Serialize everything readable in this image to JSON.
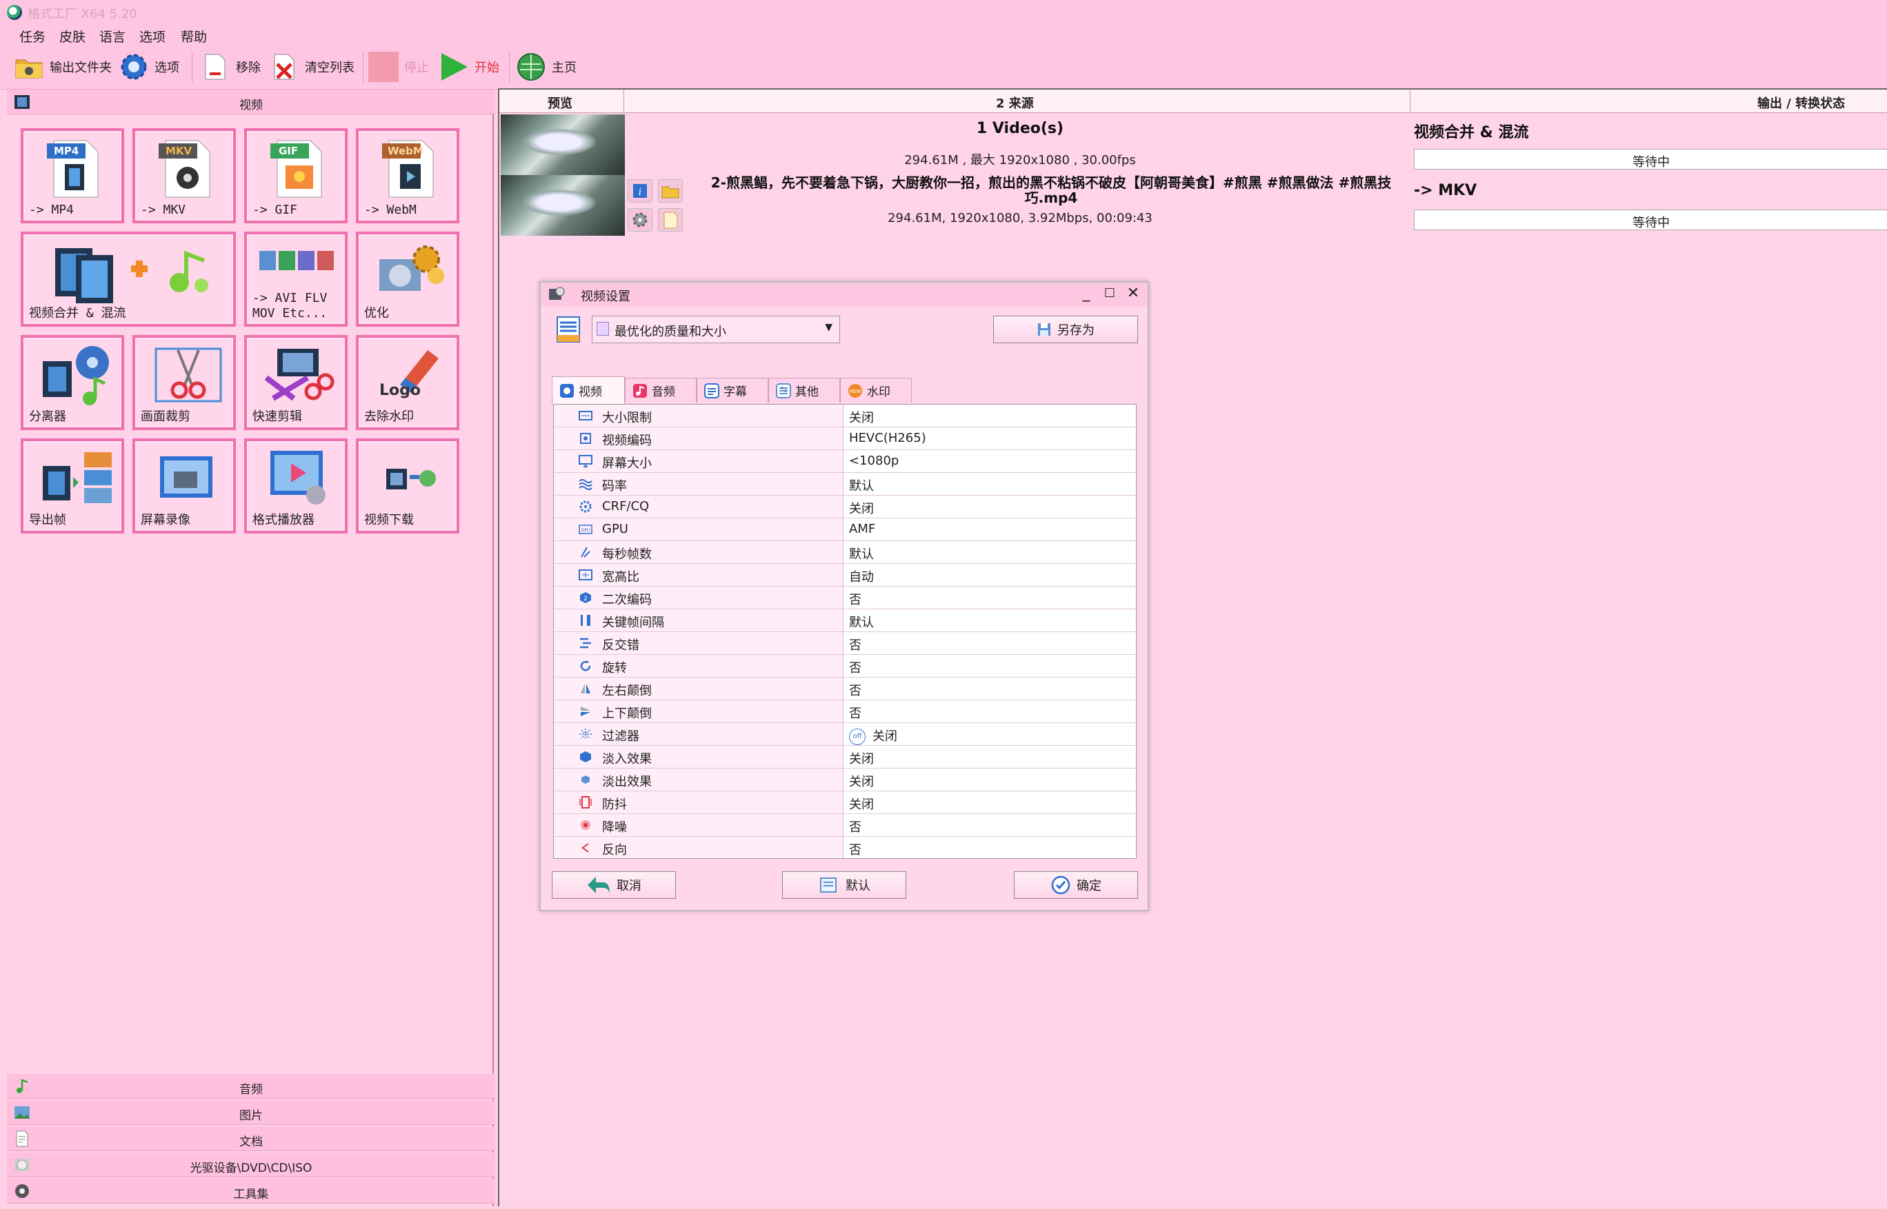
{
  "window": {
    "title": "格式工厂 X64 5.20"
  },
  "menu": [
    "任务",
    "皮肤",
    "语言",
    "选项",
    "帮助"
  ],
  "toolbar": {
    "output_folder": "输出文件夹",
    "options": "选项",
    "remove": "移除",
    "clear_list": "清空列表",
    "stop": "停止",
    "start": "开始",
    "home": "主页"
  },
  "left": {
    "video_category": "视频",
    "tiles": [
      {
        "badge": "MP4",
        "label": "-> MP4"
      },
      {
        "badge": "MKV",
        "label": "-> MKV"
      },
      {
        "badge": "GIF",
        "label": "-> GIF"
      },
      {
        "badge": "WebM",
        "label": "-> WebM"
      },
      {
        "label": "视频合并 & 混流"
      },
      {
        "label1": "-> AVI FLV",
        "label2": "MOV Etc..."
      },
      {
        "label": "优化"
      },
      {
        "label": "分离器"
      },
      {
        "label": "画面裁剪"
      },
      {
        "label": "快速剪辑"
      },
      {
        "label": "去除水印",
        "art": "Logo"
      },
      {
        "label": "导出帧"
      },
      {
        "label": "屏幕录像"
      },
      {
        "label": "格式播放器"
      },
      {
        "label": "视频下载"
      }
    ],
    "bottom_categories": [
      "音频",
      "图片",
      "文档",
      "光驱设备\\DVD\\CD\\ISO",
      "工具集"
    ]
  },
  "list": {
    "headers": {
      "preview": "预览",
      "source": "2 来源",
      "output": "输出 / 转换状态"
    },
    "rows": [
      {
        "title": "1 Video(s)",
        "info": "294.61M , 最大 1920x1080 , 30.00fps",
        "output": "视频合并 & 混流",
        "status": "等待中"
      },
      {
        "title": "2-煎黑鲳，先不要着急下锅，大厨教你一招，煎出的黑不粘锅不破皮【阿朝哥美食】#煎黑 #煎黑做法 #煎黑技巧.mp4",
        "info": "294.61M, 1920x1080, 3.92Mbps, 00:09:43",
        "output": "-> MKV",
        "status": "等待中"
      }
    ]
  },
  "dialog": {
    "title": "视频设置",
    "profile": "最优化的质量和大小",
    "save_as": "另存为",
    "tabs": [
      "视频",
      "音频",
      "字幕",
      "其他",
      "水印"
    ],
    "settings": [
      {
        "name": "大小限制",
        "value": "关闭"
      },
      {
        "name": "视频编码",
        "value": "HEVC(H265)"
      },
      {
        "name": "屏幕大小",
        "value": "<1080p"
      },
      {
        "name": "码率",
        "value": "默认"
      },
      {
        "name": "CRF/CQ",
        "value": "关闭"
      },
      {
        "name": "GPU",
        "value": "AMF"
      },
      {
        "name": "每秒帧数",
        "value": "默认"
      },
      {
        "name": "宽高比",
        "value": "自动"
      },
      {
        "name": "二次编码",
        "value": "否"
      },
      {
        "name": "关键帧间隔",
        "value": "默认"
      },
      {
        "name": "反交错",
        "value": "否"
      },
      {
        "name": "旋转",
        "value": "否"
      },
      {
        "name": "左右颠倒",
        "value": "否"
      },
      {
        "name": "上下颠倒",
        "value": "否"
      },
      {
        "name": "过滤器",
        "value": "关闭",
        "badge": "off"
      },
      {
        "name": "淡入效果",
        "value": "关闭"
      },
      {
        "name": "淡出效果",
        "value": "关闭"
      },
      {
        "name": "防抖",
        "value": "关闭"
      },
      {
        "name": "降噪",
        "value": "否"
      },
      {
        "name": "反向",
        "value": "否"
      }
    ],
    "cancel": "取消",
    "default": "默认",
    "ok": "确定"
  }
}
